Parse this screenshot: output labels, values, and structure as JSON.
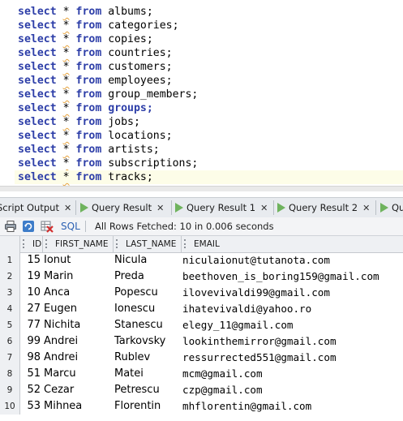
{
  "editor": {
    "lines": [
      {
        "kw": "select",
        "star": "*",
        "from": "from",
        "table": "albums;",
        "table_highlight": false
      },
      {
        "kw": "select",
        "star": "*",
        "from": "from",
        "table": "categories;",
        "table_highlight": false
      },
      {
        "kw": "select",
        "star": "*",
        "from": "from",
        "table": "copies;",
        "table_highlight": false
      },
      {
        "kw": "select",
        "star": "*",
        "from": "from",
        "table": "countries;",
        "table_highlight": false
      },
      {
        "kw": "select",
        "star": "*",
        "from": "from",
        "table": "customers;",
        "table_highlight": false
      },
      {
        "kw": "select",
        "star": "*",
        "from": "from",
        "table": "employees;",
        "table_highlight": false
      },
      {
        "kw": "select",
        "star": "*",
        "from": "from",
        "table": "group_members;",
        "table_highlight": false
      },
      {
        "kw": "select",
        "star": "*",
        "from": "from",
        "table": "groups;",
        "table_highlight": true
      },
      {
        "kw": "select",
        "star": "*",
        "from": "from",
        "table": "jobs;",
        "table_highlight": false
      },
      {
        "kw": "select",
        "star": "*",
        "from": "from",
        "table": "locations;",
        "table_highlight": false
      },
      {
        "kw": "select",
        "star": "*",
        "from": "from",
        "table": "artists;",
        "table_highlight": false
      },
      {
        "kw": "select",
        "star": "*",
        "from": "from",
        "table": "subscriptions;",
        "table_highlight": false
      },
      {
        "kw": "select",
        "star": "*",
        "from": "from",
        "table": "tracks;",
        "table_highlight": false
      }
    ]
  },
  "tabs": [
    {
      "label": "Script Output",
      "play": false
    },
    {
      "label": "Query Result",
      "play": true
    },
    {
      "label": "Query Result 1",
      "play": true
    },
    {
      "label": "Query Result 2",
      "play": true
    },
    {
      "label": "Qu",
      "play": true
    }
  ],
  "toolbar": {
    "sql_label": "SQL",
    "status": "All Rows Fetched: 10 in 0.006 seconds",
    "icons": [
      "print-icon",
      "refresh-icon",
      "clear-icon"
    ]
  },
  "grid": {
    "columns": [
      "ID",
      "FIRST_NAME",
      "LAST_NAME",
      "EMAIL"
    ],
    "rows": [
      {
        "n": "1",
        "id": "15",
        "first": "Ionut",
        "last": "Nicula",
        "email": "niculaionut@tutanota.com"
      },
      {
        "n": "2",
        "id": "19",
        "first": "Marin",
        "last": "Preda",
        "email": "beethoven_is_boring159@gmail.com"
      },
      {
        "n": "3",
        "id": "10",
        "first": "Anca",
        "last": "Popescu",
        "email": "ilovevivaldi99@gmail.com"
      },
      {
        "n": "4",
        "id": "27",
        "first": "Eugen",
        "last": "Ionescu",
        "email": "ihatevivaldi@yahoo.ro"
      },
      {
        "n": "5",
        "id": "77",
        "first": "Nichita",
        "last": "Stanescu",
        "email": "elegy_11@gmail.com"
      },
      {
        "n": "6",
        "id": "99",
        "first": "Andrei",
        "last": "Tarkovsky",
        "email": "lookinthemirror@gmail.com"
      },
      {
        "n": "7",
        "id": "98",
        "first": "Andrei",
        "last": "Rublev",
        "email": "ressurrected551@gmail.com"
      },
      {
        "n": "8",
        "id": "51",
        "first": "Marcu",
        "last": "Matei",
        "email": "mcm@gmail.com"
      },
      {
        "n": "9",
        "id": "52",
        "first": "Cezar",
        "last": "Petrescu",
        "email": "czp@gmail.com"
      },
      {
        "n": "10",
        "id": "53",
        "first": "Mihnea",
        "last": "Florentin",
        "email": "mhflorentin@gmail.com"
      }
    ]
  }
}
